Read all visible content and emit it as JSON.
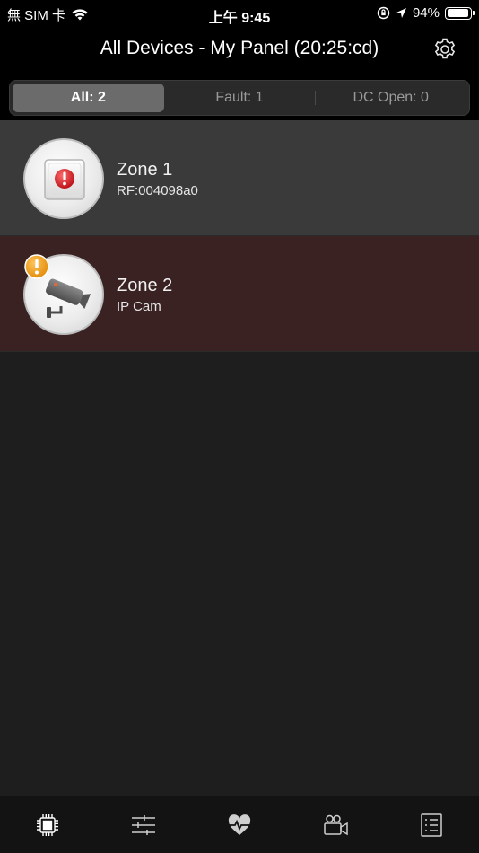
{
  "status_bar": {
    "carrier": "無 SIM 卡",
    "time": "上午 9:45",
    "battery": "94%",
    "battery_level": 0.94
  },
  "header": {
    "title": "All Devices - My Panel (20:25:cd)",
    "settings_icon": "gear-icon"
  },
  "filters": [
    {
      "label": "All: 2",
      "active": true
    },
    {
      "label": "Fault: 1",
      "active": false
    },
    {
      "label": "DC Open: 0",
      "active": false
    }
  ],
  "zones": [
    {
      "name": "Zone 1",
      "detail": "RF:004098a0",
      "icon": "alert-sensor-icon",
      "status_color": "#3a3a3a"
    },
    {
      "name": "Zone 2",
      "detail": "IP Cam",
      "icon": "camera-icon",
      "status_color": "#3a2222",
      "warning": true
    }
  ],
  "tabs": [
    {
      "name": "devices",
      "icon": "chip-icon",
      "active": true
    },
    {
      "name": "controls",
      "icon": "sliders-icon"
    },
    {
      "name": "health",
      "icon": "heartbeat-icon"
    },
    {
      "name": "video",
      "icon": "video-camera-icon"
    },
    {
      "name": "events",
      "icon": "list-icon"
    }
  ]
}
